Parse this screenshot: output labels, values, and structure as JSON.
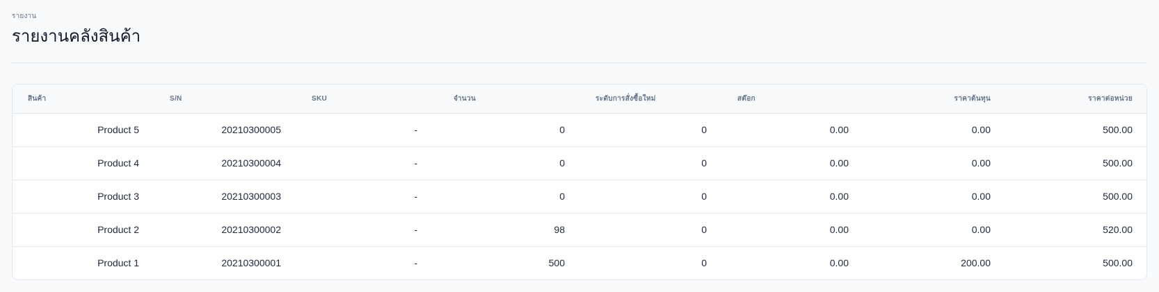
{
  "header": {
    "breadcrumb": "รายงาน",
    "title": "รายงานคลังสินค้า"
  },
  "table": {
    "columns": [
      "สินค้า",
      "S/N",
      "SKU",
      "จำนวน",
      "ระดับการสั่งซื้อใหม่",
      "สต๊อก",
      "ราคาต้นทุน",
      "ราคาต่อหน่วย"
    ],
    "rows": [
      {
        "product": "Product 5",
        "sn": "20210300005",
        "sku": "-",
        "qty": "0",
        "reorder": "0",
        "stock": "0.00",
        "cost": "0.00",
        "unit_price": "500.00"
      },
      {
        "product": "Product 4",
        "sn": "20210300004",
        "sku": "-",
        "qty": "0",
        "reorder": "0",
        "stock": "0.00",
        "cost": "0.00",
        "unit_price": "500.00"
      },
      {
        "product": "Product 3",
        "sn": "20210300003",
        "sku": "-",
        "qty": "0",
        "reorder": "0",
        "stock": "0.00",
        "cost": "0.00",
        "unit_price": "500.00"
      },
      {
        "product": "Product 2",
        "sn": "20210300002",
        "sku": "-",
        "qty": "98",
        "reorder": "0",
        "stock": "0.00",
        "cost": "0.00",
        "unit_price": "520.00"
      },
      {
        "product": "Product 1",
        "sn": "20210300001",
        "sku": "-",
        "qty": "500",
        "reorder": "0",
        "stock": "0.00",
        "cost": "200.00",
        "unit_price": "500.00"
      }
    ]
  }
}
